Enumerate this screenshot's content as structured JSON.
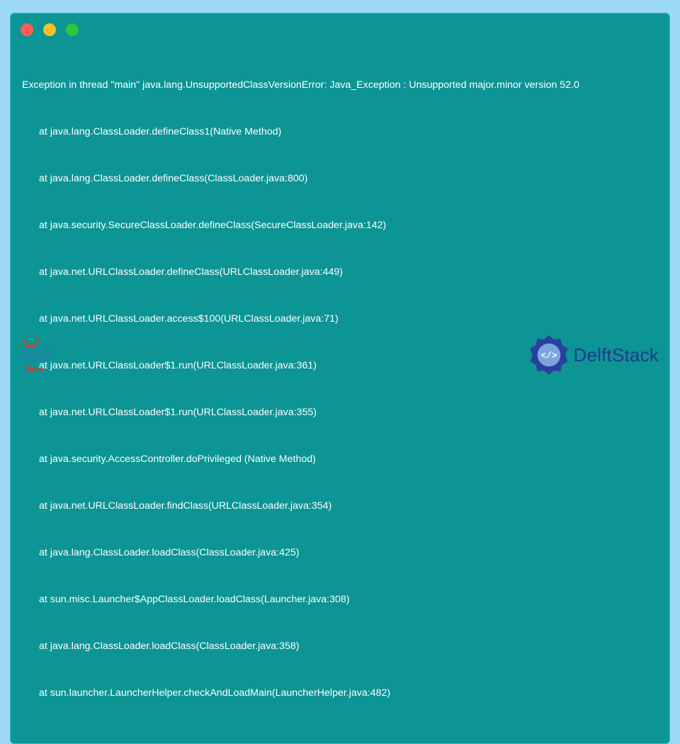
{
  "terminal": {
    "exception_header": "Exception in thread \"main\" java.lang.UnsupportedClassVersionError: Java_Exception : Unsupported major.minor version 52.0",
    "frames": [
      "at java.lang.ClassLoader.defineClass1(Native Method)",
      "at java.lang.ClassLoader.defineClass(ClassLoader.java:800)",
      "at java.security.SecureClassLoader.defineClass(SecureClassLoader.java:142)",
      "at java.net.URLClassLoader.defineClass(URLClassLoader.java:449)",
      "at java.net.URLClassLoader.access$100(URLClassLoader.java:71)",
      "at java.net.URLClassLoader$1.run(URLClassLoader.java:361)",
      "at java.net.URLClassLoader$1.run(URLClassLoader.java:355)",
      "at java.security.AccessController.doPrivileged (Native Method)",
      "at java.net.URLClassLoader.findClass(URLClassLoader.java:354)",
      "at java.lang.ClassLoader.loadClass(ClassLoader.java:425)",
      "at sun.misc.Launcher$AppClassLoader.loadClass(Launcher.java:308)",
      "at java.lang.ClassLoader.loadClass(ClassLoader.java:358)",
      "at sun.launcher.LauncherHelper.checkAndLoadMain(LauncherHelper.java:482)"
    ]
  },
  "footer": {
    "java_label": "Java",
    "delft_label": "DelftStack"
  },
  "colors": {
    "page_bg": "#9cd8f7",
    "terminal_bg": "#0d9494",
    "text": "#ffffff",
    "delft_blue": "#213a8f",
    "java_red": "#e83323",
    "java_blue": "#3174b8"
  }
}
